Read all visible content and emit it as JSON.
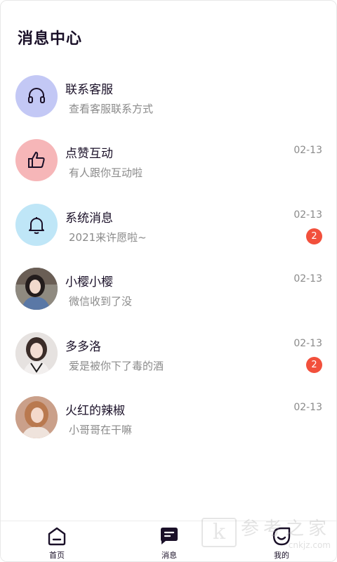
{
  "header": {
    "title": "消息中心"
  },
  "conversations": [
    {
      "name": "联系客服",
      "preview": "查看客服联系方式",
      "time": "",
      "badge": "",
      "avatar_icon": "headset-icon",
      "avatar_color": "#c3c8f5"
    },
    {
      "name": "点赞互动",
      "preview": "有人跟你互动啦",
      "time": "02-13",
      "badge": "",
      "avatar_icon": "thumbs-up-icon",
      "avatar_color": "#f6b6b8"
    },
    {
      "name": "系统消息",
      "preview": "2021来许愿啦~",
      "time": "02-13",
      "badge": "2",
      "avatar_icon": "bell-icon",
      "avatar_color": "#bfe6f7"
    },
    {
      "name": "小樱小樱",
      "preview": "微信收到了没",
      "time": "02-13",
      "badge": "",
      "avatar_icon": "user-photo",
      "avatar_color": "#5a6a80"
    },
    {
      "name": "多多洛",
      "preview": "爱是被你下了毒的酒",
      "time": "02-13",
      "badge": "2",
      "avatar_icon": "user-photo",
      "avatar_color": "#e9e4e2"
    },
    {
      "name": "火红的辣椒",
      "preview": "小哥哥在干嘛",
      "time": "02-13",
      "badge": "",
      "avatar_icon": "user-photo",
      "avatar_color": "#d8a88a"
    }
  ],
  "tabbar": {
    "home_label": "首页",
    "messages_label": "消息",
    "profile_label": "我的"
  },
  "watermark": {
    "logo_letter": "k",
    "text": "参考之家",
    "url": "cnkjz.com"
  },
  "colors": {
    "title": "#1a1028",
    "badge": "#f2503c",
    "secondary_text": "#8a8a8a"
  }
}
